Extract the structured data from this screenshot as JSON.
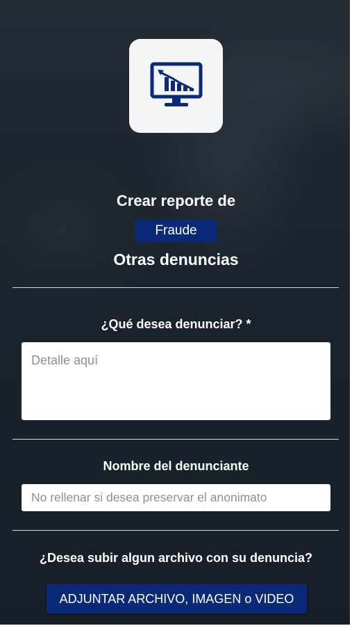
{
  "header": {
    "title_prefix": "Crear reporte de",
    "category_badge": "Fraude",
    "subcategory": "Otras denuncias",
    "logo_icon": "monitor-declining-chart-icon"
  },
  "form": {
    "complaint": {
      "label": "¿Qué desea denunciar? *",
      "placeholder": "Detalle aquí",
      "value": ""
    },
    "reporter_name": {
      "label": "Nombre del denunciante",
      "placeholder": "No rellenar si desea preservar el anonimato",
      "value": ""
    },
    "attachment": {
      "label": "¿Desea subir algun archivo con su denuncia?",
      "button_label": "ADJUNTAR ARCHIVO, IMAGEN o VIDEO"
    }
  },
  "colors": {
    "primary": "#0a2a78",
    "text_light": "#ffffff",
    "card_bg": "#f4f5f7"
  }
}
